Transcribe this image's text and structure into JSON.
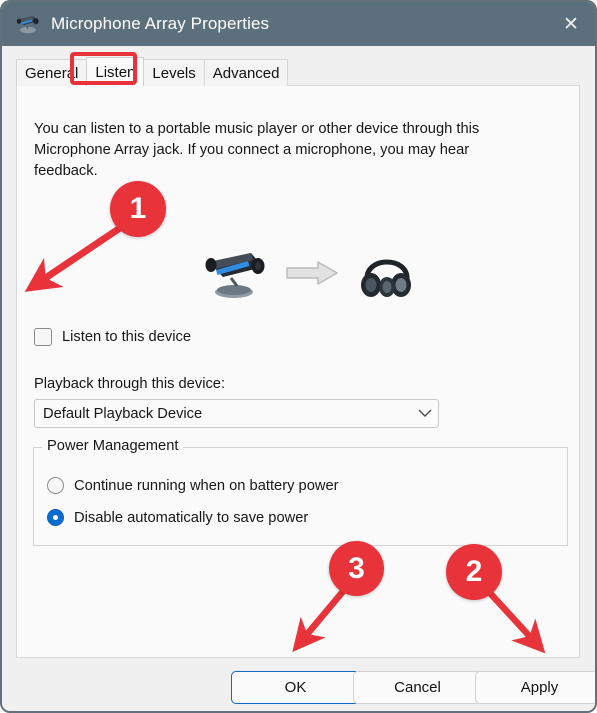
{
  "window": {
    "title": "Microphone Array Properties",
    "icon": "microphone-array-icon",
    "close_label": "✕",
    "titlebar_color": "#5c6f7c"
  },
  "tabs": [
    {
      "label": "General",
      "selected": false
    },
    {
      "label": "Listen",
      "selected": true
    },
    {
      "label": "Levels",
      "selected": false
    },
    {
      "label": "Advanced",
      "selected": false
    }
  ],
  "panel": {
    "description": "You can listen to a portable music player or other device through this Microphone Array jack.  If you connect a microphone, you may hear feedback.",
    "illustration": {
      "source_icon": "microphone-array-device-icon",
      "arrow_icon": "right-arrow-icon",
      "target_icon": "headphones-icon"
    },
    "listen_checkbox": {
      "label": "Listen to this device",
      "checked": false
    },
    "playback": {
      "label": "Playback through this device:",
      "value": "Default Playback Device",
      "chevron_icon": "chevron-down-icon",
      "options": [
        "Default Playback Device"
      ]
    },
    "power_management": {
      "legend": "Power Management",
      "options": [
        {
          "label": "Continue running when on battery power",
          "selected": false
        },
        {
          "label": "Disable automatically to save power",
          "selected": true
        }
      ],
      "accent_color": "#0a6ccf"
    }
  },
  "buttons": {
    "ok": "OK",
    "cancel": "Cancel",
    "apply": "Apply"
  },
  "annotations": {
    "accent_color": "#e8333a",
    "markers": [
      {
        "number": "1",
        "target": "listen-to-this-device-checkbox"
      },
      {
        "number": "2",
        "target": "apply-button"
      },
      {
        "number": "3",
        "target": "ok-button"
      }
    ],
    "highlight": {
      "target": "tab-listen"
    }
  }
}
